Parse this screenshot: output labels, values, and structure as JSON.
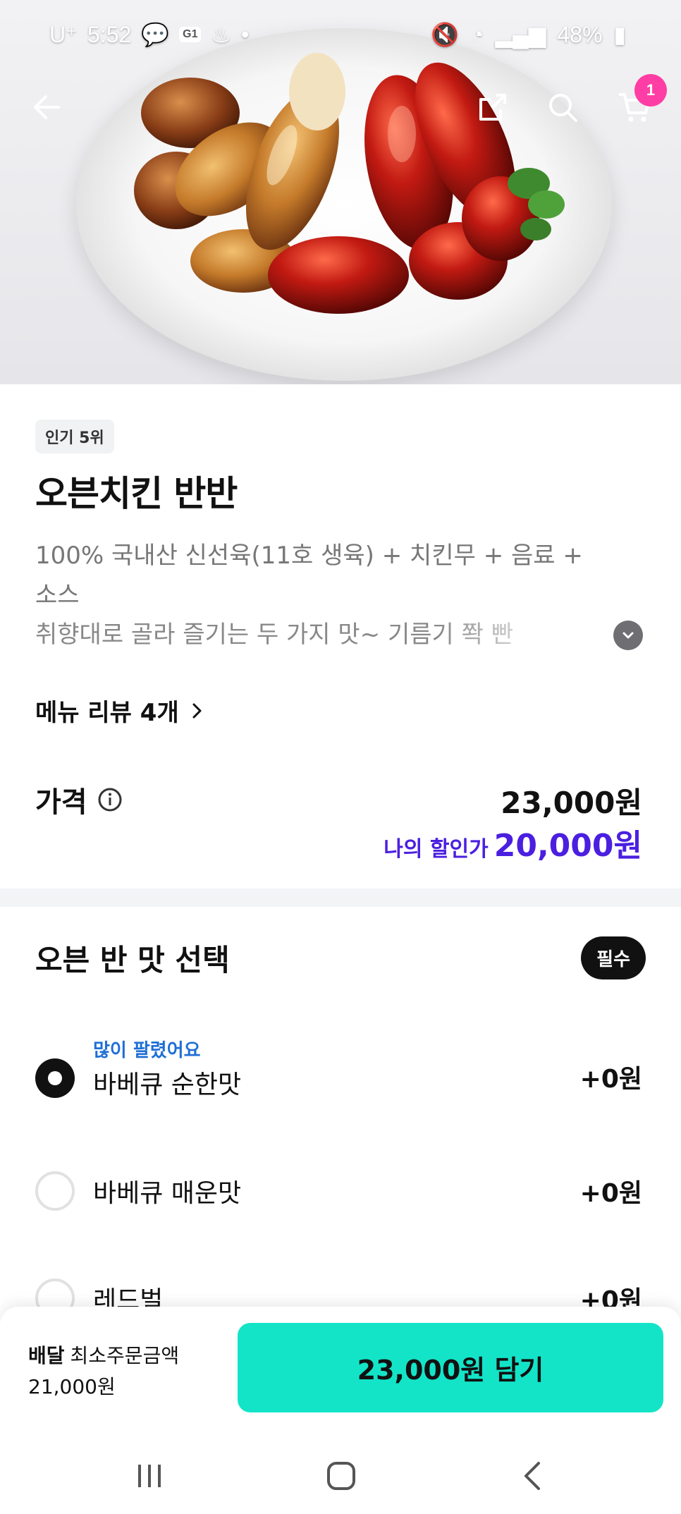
{
  "status_bar": {
    "carrier": "U⁺",
    "time": "5:52",
    "notif_badge": "G1",
    "battery": "48%"
  },
  "header": {
    "cart_count": "1"
  },
  "product": {
    "rank_badge": "인기 5위",
    "title": "오븐치킨 반반",
    "description_line1": "100% 국내산 신선육(11호 생육) + 치킨무 + 음료 +",
    "description_line2": "소스",
    "description_line3": "취향대로 골라 즐기는 두 가지 맛~ 기름기 쫙 빤",
    "reviews_label": "메뉴 리뷰 4개",
    "price_label": "가격",
    "price": "23,000원",
    "discount_label": "나의 할인가",
    "discount_price": "20,000원"
  },
  "option_group": {
    "title": "오븐 반 맛 선택",
    "required_label": "필수",
    "options": [
      {
        "tag": "많이 팔렸어요",
        "name": "바베큐 순한맛",
        "price": "+0원",
        "selected": true
      },
      {
        "tag": "",
        "name": "바베큐 매운맛",
        "price": "+0원",
        "selected": false
      },
      {
        "tag": "",
        "name": "레드벌",
        "price": "+0원",
        "selected": false
      }
    ]
  },
  "bottom_bar": {
    "delivery_label": "배달",
    "min_order_label": "최소주문금액",
    "min_order_amount": "21,000원",
    "cta_label": "23,000원 담기"
  },
  "colors": {
    "accent_mint": "#13e4c8",
    "discount_purple": "#4b1fe0",
    "tag_blue": "#1f6fd6",
    "cart_badge_pink": "#ff3ea5"
  }
}
